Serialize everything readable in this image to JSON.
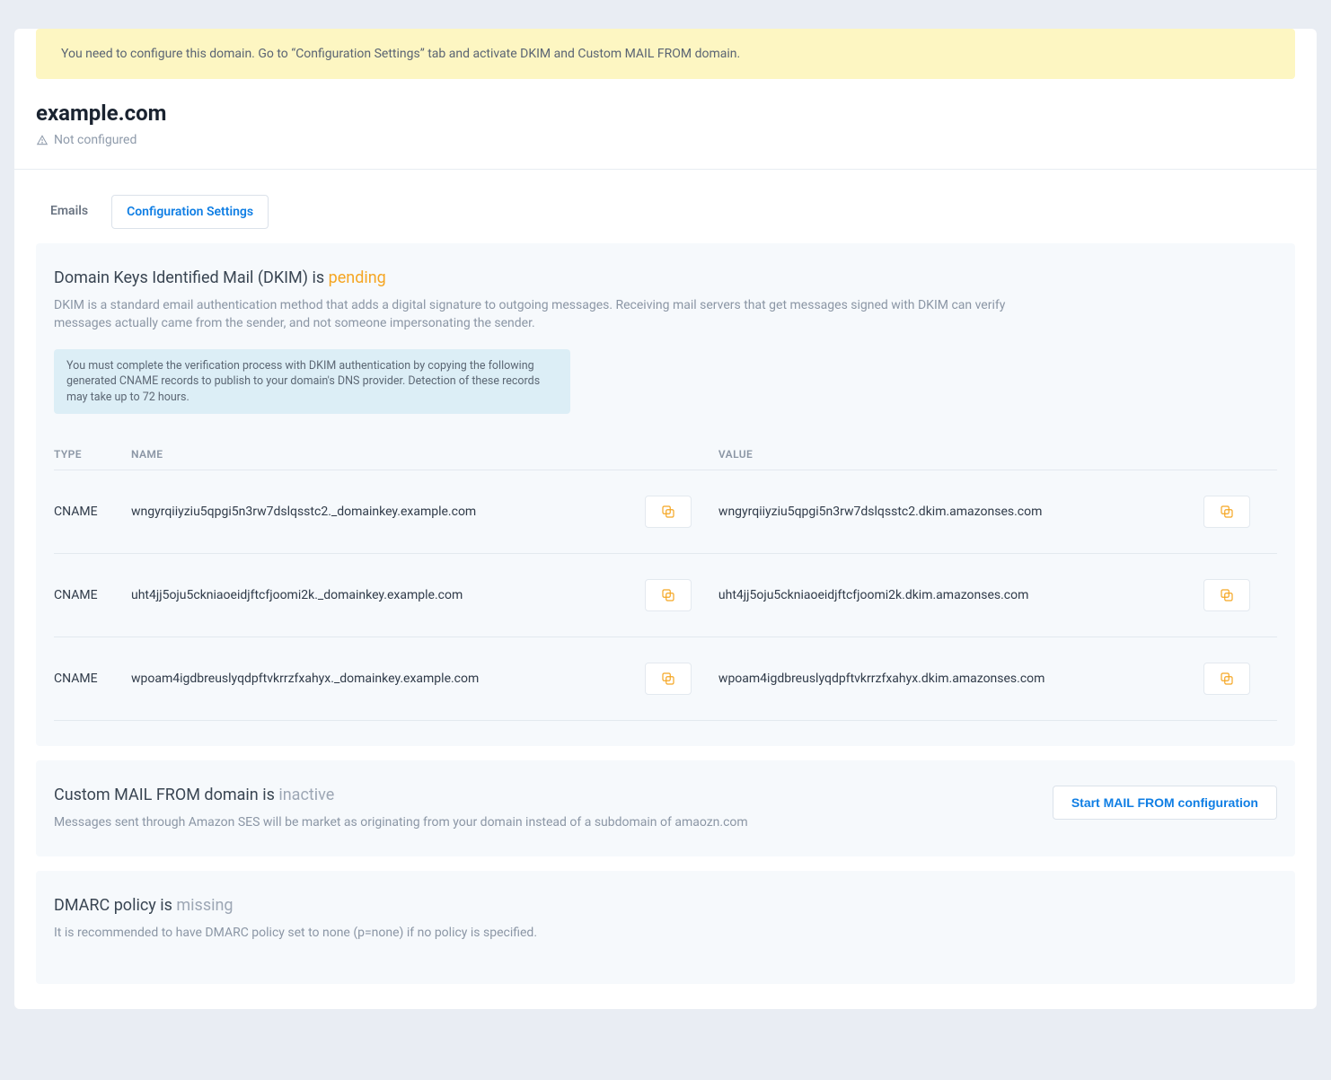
{
  "alert": {
    "text": "You need to configure this domain. Go to “Configuration Settings” tab and activate DKIM and Custom MAIL FROM domain."
  },
  "domain": {
    "name": "example.com",
    "status": "Not configured"
  },
  "tabs": {
    "emails": "Emails",
    "config": "Configuration Settings"
  },
  "dkim": {
    "heading_prefix": "Domain Keys Identified Mail (DKIM) is ",
    "status": "pending",
    "description": "DKIM is a standard email authentication method that adds a digital signature to outgoing messages. Receiving mail servers that get messages signed with DKIM can verify messages actually came from the sender, and not someone impersonating the sender.",
    "info": "You must complete the verification process with DKIM authentication by copying the following generated CNAME records to publish to your domain's DNS provider. Detection of these records may take up to 72 hours.",
    "table": {
      "col_type": "TYPE",
      "col_name": "NAME",
      "col_value": "VALUE",
      "rows": [
        {
          "type": "CNAME",
          "name": "wngyrqiiyziu5qpgi5n3rw7dslqsstc2._domainkey.example.com",
          "value": "wngyrqiiyziu5qpgi5n3rw7dslqsstc2.dkim.amazonses.com"
        },
        {
          "type": "CNAME",
          "name": "uht4jj5oju5ckniaoeidjftcfjoomi2k._domainkey.example.com",
          "value": "uht4jj5oju5ckniaoeidjftcfjoomi2k.dkim.amazonses.com"
        },
        {
          "type": "CNAME",
          "name": "wpoam4igdbreuslyqdpftvkrrzfxahyx._domainkey.example.com",
          "value": "wpoam4igdbreuslyqdpftvkrrzfxahyx.dkim.amazonses.com"
        }
      ]
    }
  },
  "mailfrom": {
    "heading_prefix": "Custom MAIL FROM domain is ",
    "status": "inactive",
    "description": "Messages sent through Amazon SES will be market as originating from your domain instead of a subdomain of amaozn.com",
    "button": "Start MAIL FROM configuration"
  },
  "dmarc": {
    "heading_prefix": "DMARC policy is ",
    "status": "missing",
    "description": "It is recommended to have DMARC policy set to none (p=none) if no policy is specified."
  }
}
